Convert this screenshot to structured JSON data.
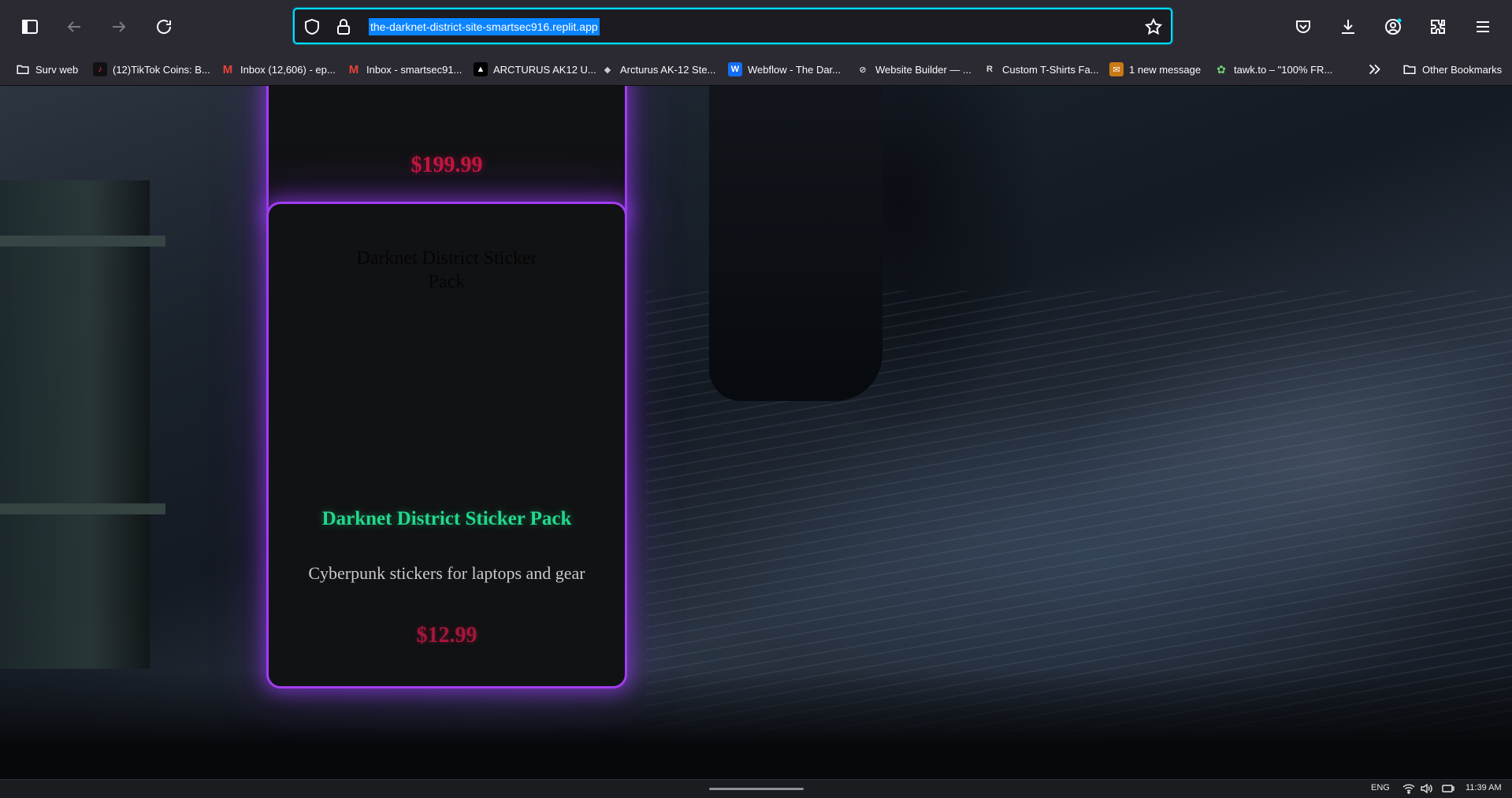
{
  "browser": {
    "url": "the-darknet-district-site-smartsec916.replit.app",
    "bookmarks": [
      {
        "label": "Surv web",
        "icon": "folder-icon"
      },
      {
        "label": "(12)TikTok Coins: B...",
        "icon": "tiktok-icon"
      },
      {
        "label": "Inbox (12,606) - ep...",
        "icon": "gmail-icon"
      },
      {
        "label": "Inbox - smartsec91...",
        "icon": "gmail-icon"
      },
      {
        "label": "ARCTURUS AK12 U...",
        "icon": "arcturus-icon"
      },
      {
        "label": "Arcturus AK-12 Ste...",
        "icon": "arcturus-icon"
      },
      {
        "label": "Webflow - The Dar...",
        "icon": "webflow-icon"
      },
      {
        "label": "Website Builder — ...",
        "icon": "squarespace-icon"
      },
      {
        "label": "Custom T-Shirts Fa...",
        "icon": "printify-icon"
      },
      {
        "label": "1 new message",
        "icon": "message-icon"
      },
      {
        "label": "tawk.to – \"100% FR...",
        "icon": "tawk-icon"
      }
    ],
    "other_bookmarks": "Other Bookmarks"
  },
  "page": {
    "top_card": {
      "price": "$199.99"
    },
    "product": {
      "image_alt": "Darknet District Sticker Pack",
      "title": "Darknet District Sticker Pack",
      "description": "Cyberpunk stickers for laptops and gear",
      "price": "$12.99"
    }
  },
  "taskbar": {
    "language": "ENG",
    "time": "11:39 AM"
  },
  "colors": {
    "card_border": "#a23cf2",
    "title_green": "#22d98c",
    "price_red": "#a4163a",
    "url_focus": "#00ddff"
  }
}
